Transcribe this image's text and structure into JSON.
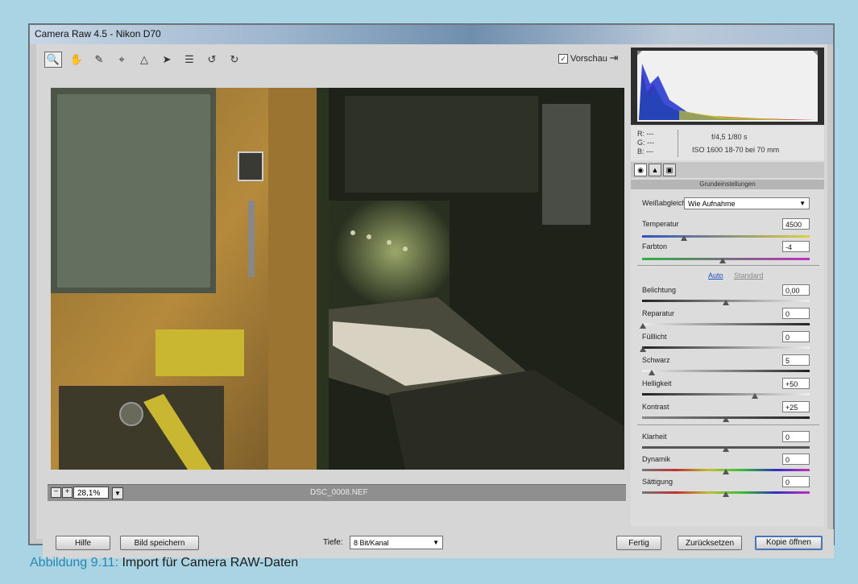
{
  "window": {
    "title": "Camera Raw 4.5 - Nikon D70"
  },
  "toolbar": {
    "tools": [
      "zoom-icon",
      "hand-icon",
      "eyedropper-icon",
      "crop-icon",
      "straighten-icon",
      "retouch-icon",
      "list-icon",
      "rotate-left-icon",
      "rotate-right-icon"
    ],
    "preview_label": "Vorschau",
    "preview_checked": "✓"
  },
  "status": {
    "zoom_value": "28,1%",
    "filename": "DSC_0008.NEF",
    "zoom_out": "−",
    "zoom_in": "+"
  },
  "meta": {
    "r": "R:  ---",
    "g": "G:  ---",
    "b": "B:  ---",
    "aperture_shutter": "f/4,5   1/80 s",
    "iso_lens": "ISO 1600   18-70 bei 70 mm"
  },
  "panel": {
    "section_title": "Grundeinstellungen",
    "wb_label": "Weißabgleich:",
    "wb_value": "Wie Aufnahme",
    "auto": "Auto",
    "standard": "Standard",
    "sliders": [
      {
        "label": "Temperatur",
        "value": "4500",
        "level": 0.25
      },
      {
        "label": "Farbton",
        "value": "-4",
        "level": 0.48
      },
      {
        "label": "Belichtung",
        "value": "0,00",
        "level": 0.5
      },
      {
        "label": "Reparatur",
        "value": "0",
        "level": 0.0
      },
      {
        "label": "Fülllicht",
        "value": "0",
        "level": 0.0
      },
      {
        "label": "Schwarz",
        "value": "5",
        "level": 0.05
      },
      {
        "label": "Helligkeit",
        "value": "+50",
        "level": 0.67
      },
      {
        "label": "Kontrast",
        "value": "+25",
        "level": 0.5
      },
      {
        "label": "Klarheit",
        "value": "0",
        "level": 0.5
      },
      {
        "label": "Dynamik",
        "value": "0",
        "level": 0.5
      },
      {
        "label": "Sättigung",
        "value": "0",
        "level": 0.5
      }
    ]
  },
  "bottom": {
    "help": "Hilfe",
    "save": "Bild speichern",
    "depth_label": "Tiefe:",
    "depth_value": "8 Bit/Kanal",
    "done": "Fertig",
    "reset": "Zurücksetzen",
    "open_copy": "Kopie öffnen"
  },
  "caption": {
    "label": "Abbildung 9.11:",
    "text": " Import für Camera RAW-Daten"
  }
}
